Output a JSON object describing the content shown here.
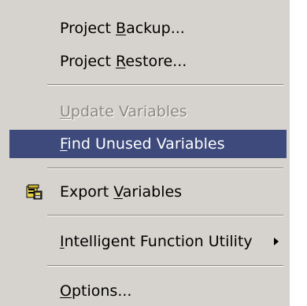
{
  "menu": {
    "items": [
      {
        "id": "project-backup",
        "pre": "Project ",
        "key": "B",
        "post": "ackup...",
        "state": "normal"
      },
      {
        "id": "project-restore",
        "pre": "Project ",
        "key": "R",
        "post": "estore...",
        "state": "normal"
      },
      {
        "id": "update-variables",
        "pre": "",
        "key": "U",
        "post": "pdate Variables",
        "state": "disabled"
      },
      {
        "id": "find-unused-variables",
        "pre": "",
        "key": "F",
        "post": "ind Unused Variables",
        "state": "highlighted"
      },
      {
        "id": "export-variables",
        "pre": "Export ",
        "key": "V",
        "post": "ariables",
        "state": "normal",
        "icon": "export-variables-icon"
      },
      {
        "id": "intelligent-function-utility",
        "pre": "",
        "key": "I",
        "post": "ntelligent Function Utility",
        "state": "normal",
        "submenu_icon": "submenu-arrow-icon"
      },
      {
        "id": "options",
        "pre": "",
        "key": "O",
        "post": "ptions...",
        "state": "normal"
      }
    ],
    "colors": {
      "background": "#d6d3ce",
      "highlight": "#3d4a7b",
      "highlight_text": "#ffffff",
      "disabled_text": "#8a8781"
    }
  }
}
